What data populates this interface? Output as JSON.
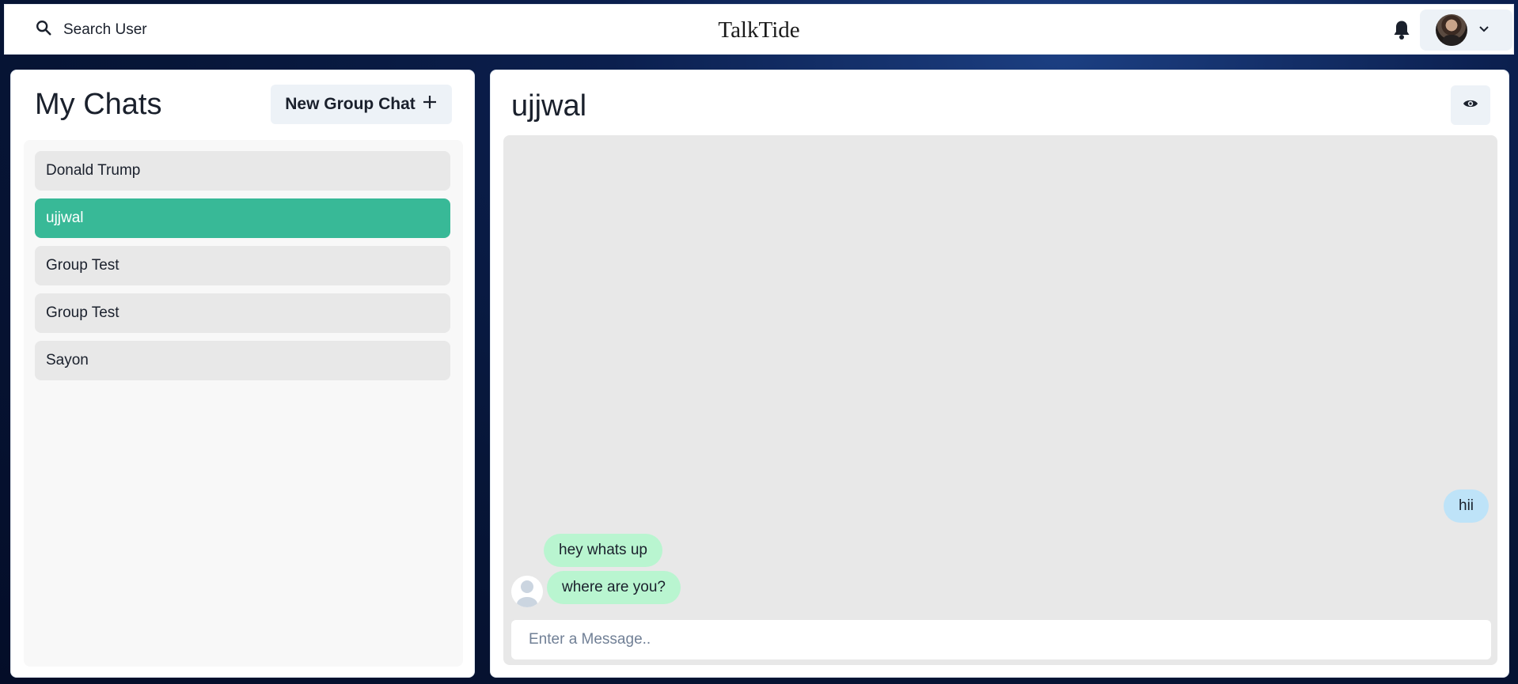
{
  "header": {
    "search_label": "Search User",
    "brand": "TalkTide",
    "icons": {
      "search": "search-icon",
      "bell": "bell-icon",
      "chevron": "chevron-down-icon"
    }
  },
  "sidebar": {
    "title": "My Chats",
    "new_group_label": "New Group Chat",
    "chats": [
      {
        "name": "Donald Trump",
        "active": false
      },
      {
        "name": "ujjwal",
        "active": true
      },
      {
        "name": "Group Test",
        "active": false
      },
      {
        "name": "Group Test",
        "active": false
      },
      {
        "name": "Sayon",
        "active": false
      }
    ]
  },
  "chat": {
    "title": "ujjwal",
    "messages": [
      {
        "text": "hii",
        "from": "me"
      },
      {
        "text": "hey whats up",
        "from": "them"
      },
      {
        "text": "where are you?",
        "from": "them"
      }
    ],
    "input_placeholder": "Enter a Message.."
  },
  "colors": {
    "active_chat": "#38b997",
    "my_bubble": "#bee3f8",
    "their_bubble": "#b9f5d0",
    "background": "#071638"
  }
}
